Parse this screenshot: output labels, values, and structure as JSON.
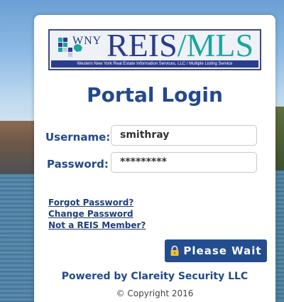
{
  "logo": {
    "prefix": "WNY",
    "main": "REIS",
    "suffix": "/MLS",
    "tagline": "Western New York Real Estate Information Services, LLC / Multiple Listing Service"
  },
  "page_title": "Portal Login",
  "form": {
    "username_label": "Username:",
    "username_value": "smithray",
    "password_label": "Password:",
    "password_value": "*********"
  },
  "links": {
    "forgot_password": "Forgot Password?",
    "change_password": "Change Password",
    "not_member": "Not a REIS Member?"
  },
  "submit_button": {
    "icon": "lock-icon",
    "label": "Please Wait"
  },
  "footer": {
    "powered_by": "Powered by Clareity Security LLC",
    "copyright": "© Copyright 2016"
  },
  "colors": {
    "brand_blue": "#22498c",
    "button_blue": "#234d8e",
    "logo_teal": "#1aa5a0"
  }
}
